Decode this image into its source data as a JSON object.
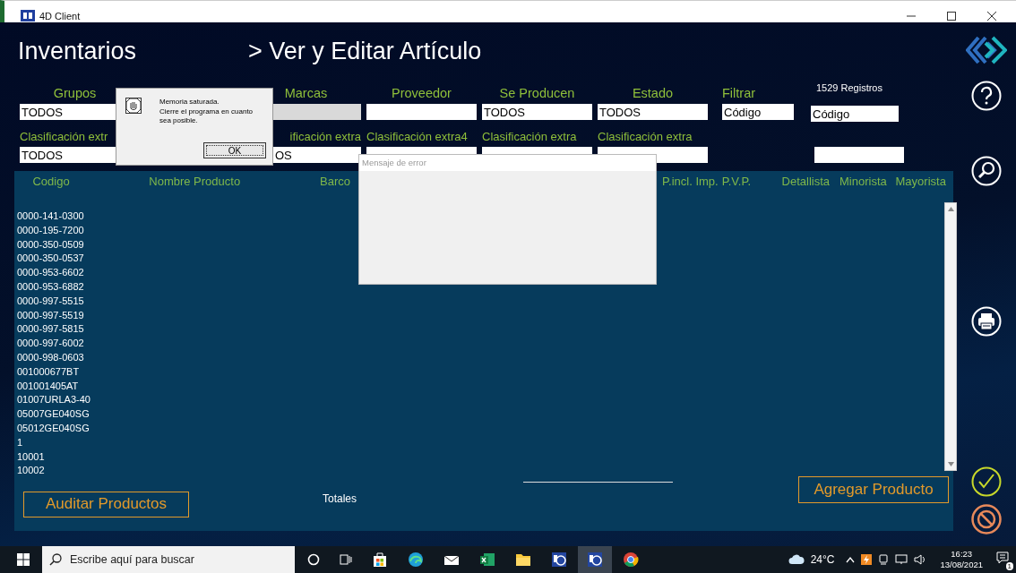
{
  "window": {
    "title": "4D Client"
  },
  "header": {
    "module": "Inventarios",
    "section": "> Ver y Editar Artículo"
  },
  "filters_row1": [
    {
      "label": "Grupos",
      "value": "TODOS",
      "disabled": false
    },
    {
      "label": "Marcas",
      "disabled": true
    },
    {
      "label": "Proveedor",
      "disabled": false
    },
    {
      "label": "Se Producen",
      "value": "TODOS",
      "disabled": false
    },
    {
      "label": "Estado",
      "value": "TODOS",
      "disabled": false
    }
  ],
  "filter": {
    "label": "Filtrar",
    "value": "Código"
  },
  "records": {
    "count": "1529 Registros",
    "value": "Código"
  },
  "filters_row2": [
    {
      "label": "Clasificación extr",
      "value": "TODOS"
    },
    {
      "label": "ificación extra",
      "value": "OS"
    },
    {
      "label": "Clasificación extra4"
    },
    {
      "label": "Clasificación extra"
    },
    {
      "label": "Clasificación extra"
    }
  ],
  "table": {
    "columns": [
      "Codigo",
      "Nombre Producto",
      "Barco",
      "P.incl. Imp.",
      "P.V.P.",
      "Detallista",
      "Minorista",
      "Mayorista"
    ],
    "rows": [
      "0000-141-0300",
      "0000-195-7200",
      "0000-350-0509",
      "0000-350-0537",
      "0000-953-6602",
      "0000-953-6882",
      "0000-997-5515",
      "0000-997-5519",
      "0000-997-5815",
      "0000-997-6002",
      "0000-998-0603",
      "001000677BT",
      "001001405AT",
      "01007URLA3-40",
      "05007GE040SG",
      "05012GE040SG",
      "1",
      "10001",
      "10002"
    ]
  },
  "footer": {
    "audit_button": "Auditar Productos",
    "totals_label": "Totales",
    "add_button": "Agregar Producto"
  },
  "alert": {
    "lines": [
      "Memoria saturada.",
      "Cierre el programa en cuanto",
      "sea posible."
    ],
    "button": "OK"
  },
  "error_window": {
    "title": "Mensaje de error"
  },
  "taskbar": {
    "search_placeholder": "Escribe aquí para buscar",
    "temperature": "24°C",
    "time": "16:23",
    "date": "13/08/2021",
    "notifications": "1"
  }
}
